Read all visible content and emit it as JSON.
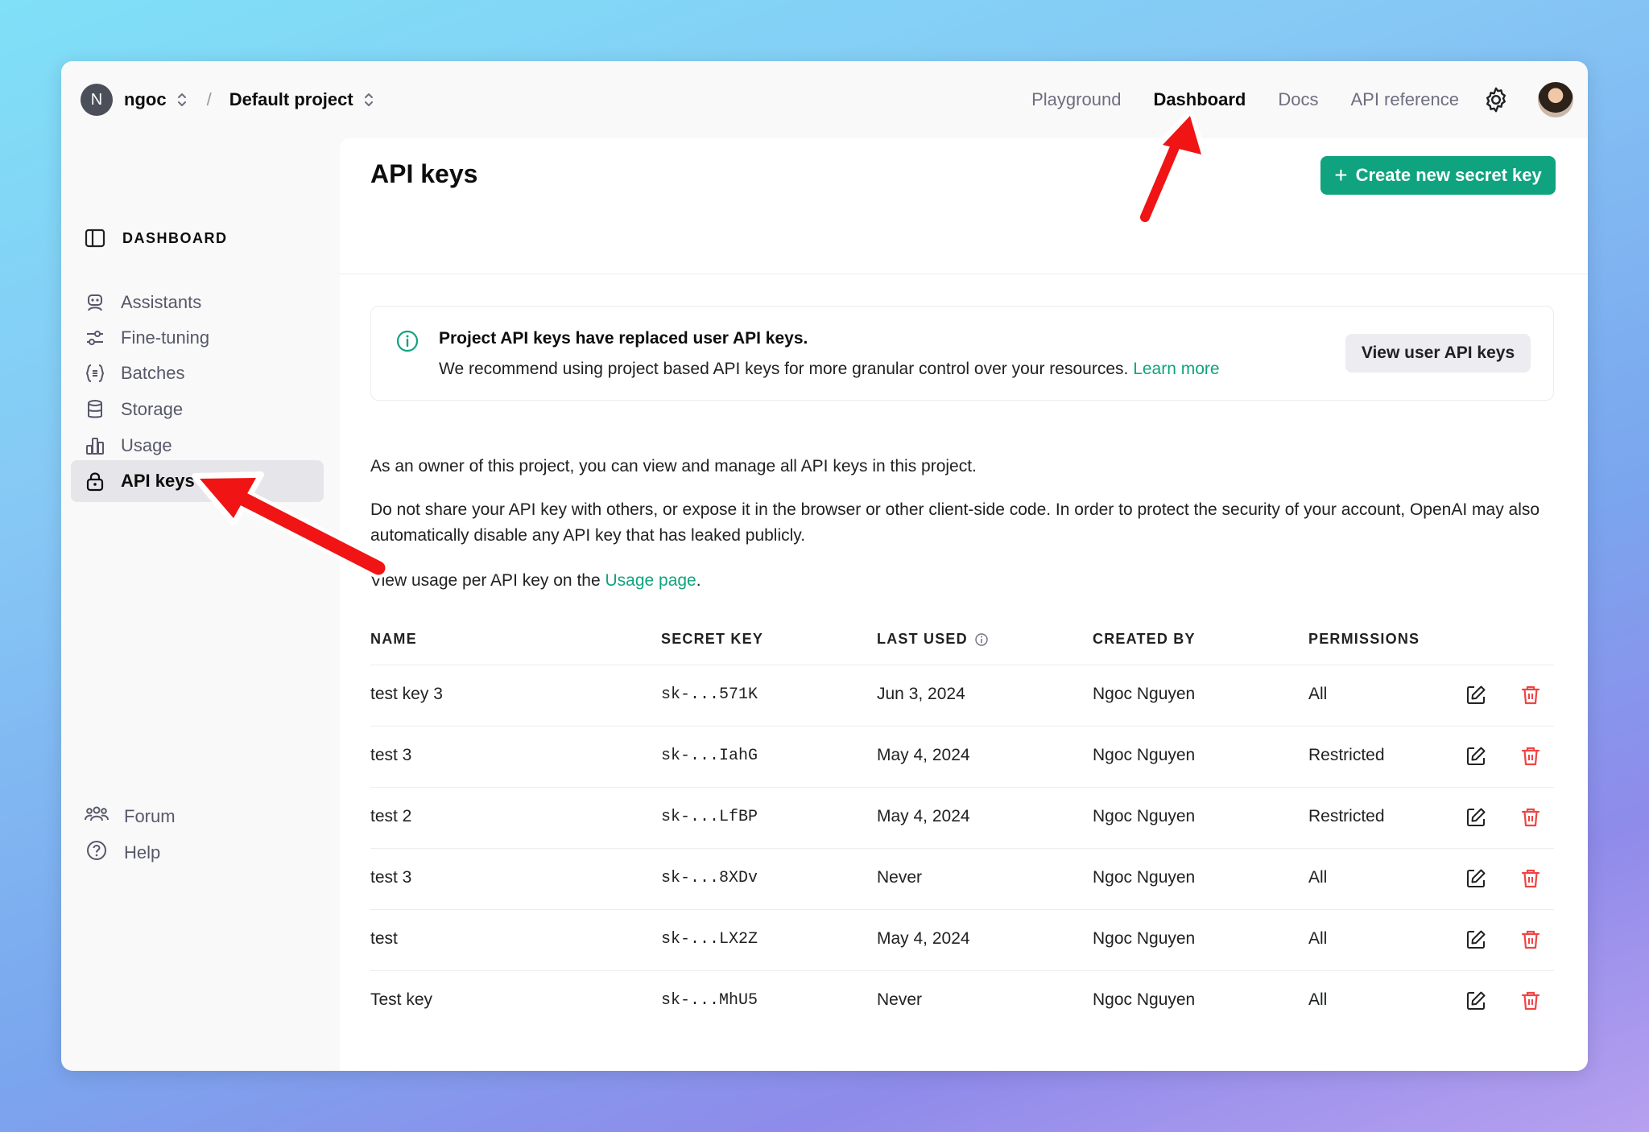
{
  "topbar": {
    "org_initial": "N",
    "org_name": "ngoc",
    "separator": "/",
    "project_name": "Default project",
    "nav": [
      "Playground",
      "Dashboard",
      "Docs",
      "API reference"
    ],
    "active_nav": "Dashboard",
    "icons": [
      "chevron-updown-icon",
      "gear-icon",
      "user-avatar"
    ]
  },
  "sidebar": {
    "header": "DASHBOARD",
    "items": [
      {
        "label": "Assistants",
        "icon": "robot-icon"
      },
      {
        "label": "Fine-tuning",
        "icon": "sliders-icon"
      },
      {
        "label": "Batches",
        "icon": "braces-icon"
      },
      {
        "label": "Storage",
        "icon": "database-icon"
      },
      {
        "label": "Usage",
        "icon": "bar-chart-icon"
      },
      {
        "label": "API keys",
        "icon": "lock-icon"
      }
    ],
    "active_item": "API keys",
    "footer": [
      {
        "label": "Forum",
        "icon": "people-icon"
      },
      {
        "label": "Help",
        "icon": "help-icon"
      }
    ]
  },
  "main": {
    "title": "API keys",
    "create_button": "Create new secret key",
    "notice": {
      "title": "Project API keys have replaced user API keys.",
      "text": "We recommend using project based API keys for more granular control over your resources.",
      "link": "Learn more",
      "button": "View user API keys"
    },
    "para1": "As an owner of this project, you can view and manage all API keys in this project.",
    "para2": "Do not share your API key with others, or expose it in the browser or other client-side code. In order to protect the security of your account, OpenAI may also automatically disable any API key that has leaked publicly.",
    "para3_prefix": "View usage per API key on the",
    "para3_link": "Usage page",
    "para3_suffix": ".",
    "table": {
      "columns": [
        "NAME",
        "SECRET KEY",
        "LAST USED",
        "CREATED BY",
        "PERMISSIONS"
      ],
      "rows": [
        {
          "name": "test key 3",
          "key": "sk-...571K",
          "last_used": "Jun 3, 2024",
          "created_by": "Ngoc Nguyen",
          "permissions": "All"
        },
        {
          "name": "test 3",
          "key": "sk-...IahG",
          "last_used": "May 4, 2024",
          "created_by": "Ngoc Nguyen",
          "permissions": "Restricted"
        },
        {
          "name": "test 2",
          "key": "sk-...LfBP",
          "last_used": "May 4, 2024",
          "created_by": "Ngoc Nguyen",
          "permissions": "Restricted"
        },
        {
          "name": "test 3",
          "key": "sk-...8XDv",
          "last_used": "Never",
          "created_by": "Ngoc Nguyen",
          "permissions": "All"
        },
        {
          "name": "test",
          "key": "sk-...LX2Z",
          "last_used": "May 4, 2024",
          "created_by": "Ngoc Nguyen",
          "permissions": "All"
        },
        {
          "name": "Test key",
          "key": "sk-...MhU5",
          "last_used": "Never",
          "created_by": "Ngoc Nguyen",
          "permissions": "All"
        }
      ]
    }
  },
  "colors": {
    "accent": "#10a37f",
    "danger": "#ef4444",
    "annotation_arrow": "#f01414"
  }
}
